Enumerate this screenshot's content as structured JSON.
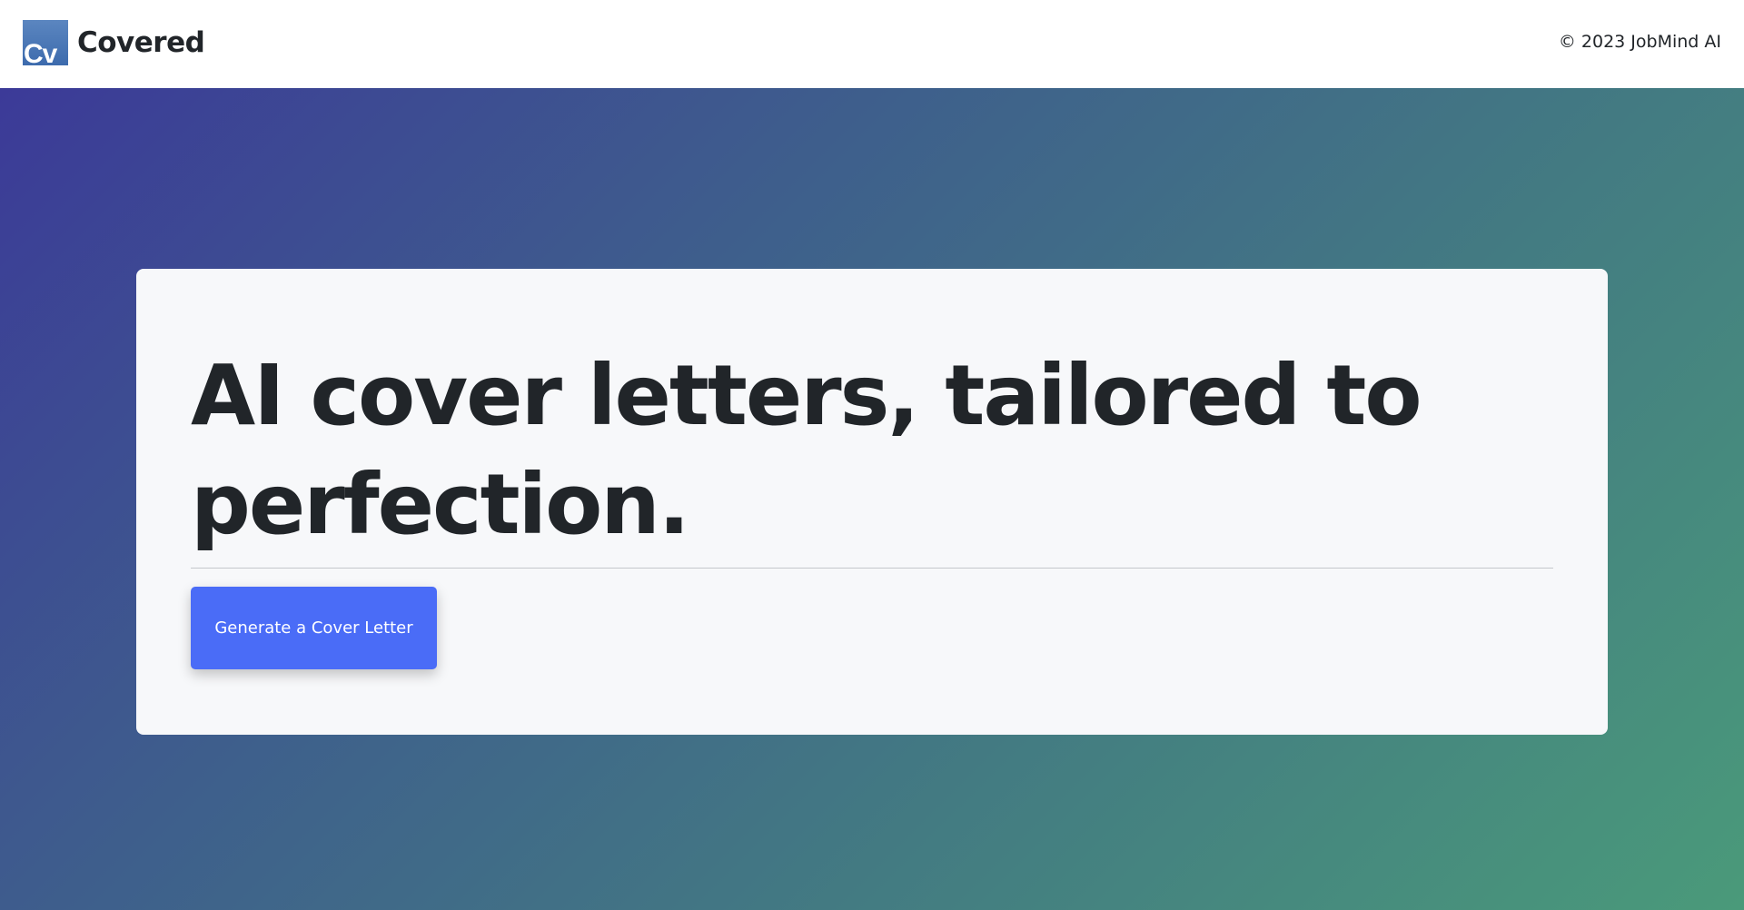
{
  "header": {
    "logo_text": "Cv",
    "brand_name": "Covered",
    "copyright": "© 2023 JobMind AI"
  },
  "hero": {
    "headline": "AI cover letters, tailored to perfection.",
    "cta_label": "Generate a Cover Letter"
  },
  "colors": {
    "primary_button": "#4a6cf7",
    "gradient_start": "#3c3a98",
    "gradient_end": "#4a9a7a",
    "card_background": "#f7f8fa",
    "text_dark": "#212529"
  }
}
